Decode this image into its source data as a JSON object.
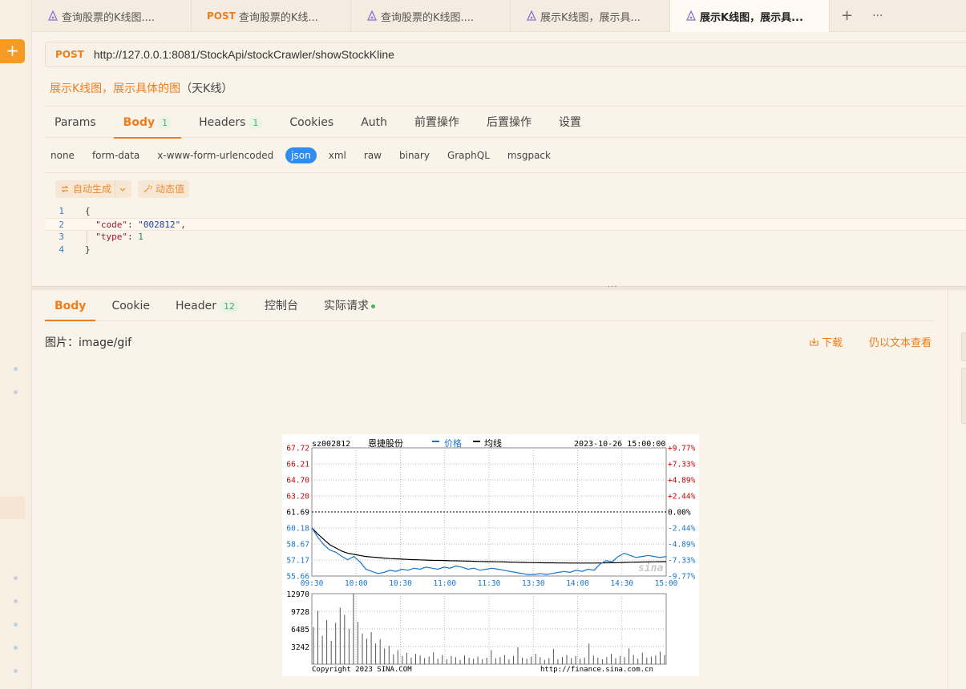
{
  "tabs": [
    {
      "method": "",
      "label": "查询股票的K线图...."
    },
    {
      "method": "POST",
      "label": "查询股票的K线..."
    },
    {
      "method": "",
      "label": "查询股票的K线图...."
    },
    {
      "method": "",
      "label": "展示K线图，展示具..."
    },
    {
      "method": "",
      "label": "展示K线图，展示具...",
      "active": true
    }
  ],
  "tab_tools": {
    "add": "+",
    "more": "···"
  },
  "sidebar": {
    "add_button": "+"
  },
  "request": {
    "method": "POST",
    "url": "http://127.0.0.1:8081/StockApi/stockCrawler/showStockKline",
    "title_main": "展示K线图，展示具体的图",
    "title_rest": "（天K线）"
  },
  "req_tabs": [
    {
      "label": "Params"
    },
    {
      "label": "Body",
      "count": "1",
      "active": true
    },
    {
      "label": "Headers",
      "count": "1"
    },
    {
      "label": "Cookies"
    },
    {
      "label": "Auth"
    },
    {
      "label": "前置操作"
    },
    {
      "label": "后置操作"
    },
    {
      "label": "设置"
    }
  ],
  "body_types": [
    "none",
    "form-data",
    "x-www-form-urlencoded",
    "json",
    "xml",
    "raw",
    "binary",
    "GraphQL",
    "msgpack"
  ],
  "body_type_selected": "json",
  "editor": {
    "auto_generate": "自动生成",
    "dynamic_value": "动态值",
    "lines": [
      {
        "no": "1",
        "text": "{"
      },
      {
        "no": "2",
        "key": "\"code\"",
        "value": "\"002812\"",
        "comma": ","
      },
      {
        "no": "3",
        "key": "\"type\"",
        "value": "1",
        "comma": ""
      },
      {
        "no": "4",
        "text": "}"
      }
    ]
  },
  "splitter_handle": "···",
  "response": {
    "tabs": [
      {
        "label": "Body",
        "active": true
      },
      {
        "label": "Cookie"
      },
      {
        "label": "Header",
        "count": "12"
      },
      {
        "label": "控制台"
      },
      {
        "label": "实际请求",
        "dot": true
      }
    ],
    "image_label": "图片：image/gif",
    "download": "下载",
    "view_as_text": "仍以文本查看"
  },
  "chart_data": {
    "type": "line",
    "symbol": "sz002812",
    "name": "恩捷股份",
    "legend": [
      {
        "name": "价格",
        "color": "#1874cd"
      },
      {
        "name": "均线",
        "color": "#000000"
      }
    ],
    "datetime": "2023-10-26 15:00:00",
    "price_ticks": [
      "67.72",
      "66.21",
      "64.70",
      "63.20",
      "61.69",
      "60.18",
      "58.67",
      "57.17",
      "55.66"
    ],
    "pct_ticks": [
      "+9.77%",
      "+7.33%",
      "+4.89%",
      "+2.44%",
      "0.00%",
      "-2.44%",
      "-4.89%",
      "-7.33%",
      "-9.77%"
    ],
    "time_ticks": [
      "09:30",
      "10:00",
      "10:30",
      "11:00",
      "11:30",
      "13:30",
      "14:00",
      "14:30",
      "15:00"
    ],
    "ylim": [
      55.66,
      67.72
    ],
    "prev_close": 61.69,
    "price": [
      60.2,
      59.3,
      58.6,
      58.1,
      57.9,
      57.5,
      57.2,
      57.5,
      57.0,
      56.3,
      56.1,
      55.9,
      56.0,
      56.2,
      56.1,
      56.3,
      56.2,
      56.4,
      56.3,
      56.5,
      56.4,
      56.3,
      56.5,
      56.4,
      56.6,
      56.5,
      56.3,
      56.4,
      56.2,
      56.3,
      56.4,
      56.3,
      56.2,
      56.1,
      56.0,
      55.9,
      55.8,
      55.8,
      55.9,
      55.8,
      55.9,
      56.0,
      56.1,
      56.0,
      56.2,
      56.1,
      56.3,
      56.2,
      56.8,
      57.1,
      57.0,
      57.5,
      57.8,
      57.6,
      57.4,
      57.5,
      57.6,
      57.5,
      57.4,
      57.5
    ],
    "avg": [
      60.2,
      59.6,
      59.1,
      58.6,
      58.3,
      58.0,
      57.8,
      57.7,
      57.6,
      57.5,
      57.45,
      57.4,
      57.35,
      57.3,
      57.28,
      57.25,
      57.22,
      57.2,
      57.18,
      57.16,
      57.14,
      57.13,
      57.12,
      57.1,
      57.09,
      57.08,
      57.06,
      57.05,
      57.03,
      57.02,
      57.01,
      57.0,
      56.99,
      56.97,
      56.96,
      56.94,
      56.93,
      56.92,
      56.91,
      56.9,
      56.9,
      56.89,
      56.89,
      56.88,
      56.88,
      56.88,
      56.88,
      56.88,
      56.89,
      56.9,
      56.91,
      56.92,
      56.94,
      56.96,
      56.97,
      56.98,
      56.99,
      57.0,
      57.01,
      57.02
    ],
    "volume_ticks": [
      "12970",
      "9728",
      "6485",
      "3242"
    ],
    "volume_max": 12970,
    "volume": [
      6800,
      9800,
      5200,
      8100,
      4300,
      7600,
      10400,
      9100,
      6500,
      12970,
      7800,
      5600,
      4700,
      5900,
      3800,
      4600,
      2900,
      3400,
      1800,
      2600,
      1500,
      2100,
      1200,
      1900,
      1600,
      1100,
      1400,
      2200,
      1000,
      1700,
      900,
      1500,
      1300,
      800,
      1600,
      1200,
      1000,
      1400,
      900,
      1200,
      2600,
      1100,
      1300,
      1700,
      900,
      1500,
      3100,
      1200,
      1000,
      1400,
      1900,
      1300,
      800,
      1100,
      2800,
      900,
      1300,
      1700,
      1100,
      1500,
      1000,
      1200,
      3800,
      1600,
      1200,
      900,
      1300,
      1900,
      1100,
      1500,
      1300,
      2900,
      1700,
      1000,
      2100,
      1200,
      1400,
      1600,
      2300,
      1700
    ],
    "copyright": "Copyright 2023 SINA.COM",
    "url": "http://finance.sina.com.cn",
    "watermark": "sina"
  }
}
